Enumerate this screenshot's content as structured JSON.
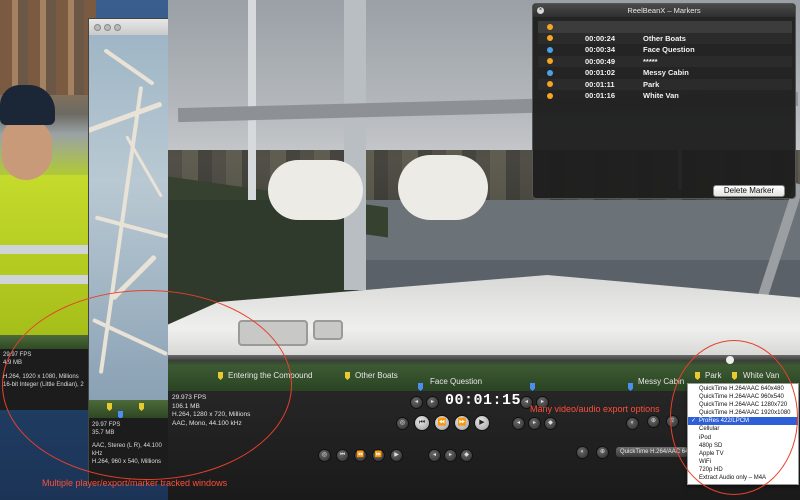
{
  "police_window": {
    "fps": "29.97 FPS",
    "size": "4.9 MB",
    "video": "H.264, 1920 x 1080, Millions",
    "audio": "16-bit Integer (Little Endian), 2"
  },
  "tree_window": {
    "fps": "29.97 FPS",
    "size": "35.7 MB",
    "audio": "AAC, Stereo (L R), 44.100 kHz",
    "video": "H.264, 960 x 540, Millions"
  },
  "main_window": {
    "fps": "29.973 FPS",
    "size": "106.1 MB",
    "video": "H.264, 1280 x 720, Millions",
    "audio": "AAC, Mono, 44.100 kHz",
    "timecode": "00:01:15",
    "timeline_markers": [
      {
        "label": "Entering the Compound",
        "color": "yellow"
      },
      {
        "label": "Other Boats",
        "color": "yellow"
      },
      {
        "label": "Face Question",
        "color": "blue"
      },
      {
        "label": "Messy Cabin",
        "color": "blue"
      },
      {
        "label": "Park",
        "color": "yellow"
      },
      {
        "label": "White Van",
        "color": "yellow"
      }
    ],
    "export_selected": "QuickTime H.264/AAC 640x480"
  },
  "markers_window": {
    "title": "ReelBeanX – Markers",
    "rows": [
      {
        "time": "",
        "name": "",
        "color": "#f5a623"
      },
      {
        "time": "00:00:24",
        "name": "Other Boats",
        "color": "#f5a623"
      },
      {
        "time": "00:00:34",
        "name": "Face Question",
        "color": "#4aa3e8"
      },
      {
        "time": "00:00:49",
        "name": "*****",
        "color": "#f5a623"
      },
      {
        "time": "00:01:02",
        "name": "Messy Cabin",
        "color": "#4aa3e8"
      },
      {
        "time": "00:01:11",
        "name": "Park",
        "color": "#f5a623"
      },
      {
        "time": "00:01:16",
        "name": "White Van",
        "color": "#f5a623"
      }
    ],
    "delete_button": "Delete Marker"
  },
  "export_menu": {
    "items": [
      "QuickTime H.264/AAC 640x480",
      "QuickTime H.264/AAC 960x540",
      "QuickTime H.264/AAC 1280x720",
      "QuickTime H.264/AAC 1920x1080",
      "ProRes 422/LPCM",
      "Cellular",
      "iPod",
      "480p SD",
      "Apple TV",
      "WiFi",
      "720p HD",
      "Extract Audio only – M4A"
    ],
    "selected_index": 4,
    "check": "✓"
  },
  "annotations": {
    "windows": "Multiple player/export/marker tracked windows",
    "export": "Many video/audio export options"
  },
  "colors": {
    "accent_red": "#e8402b",
    "marker_yellow": "#e8c92f",
    "marker_blue": "#4b8ef5",
    "selection_blue": "#2f5fd6"
  }
}
